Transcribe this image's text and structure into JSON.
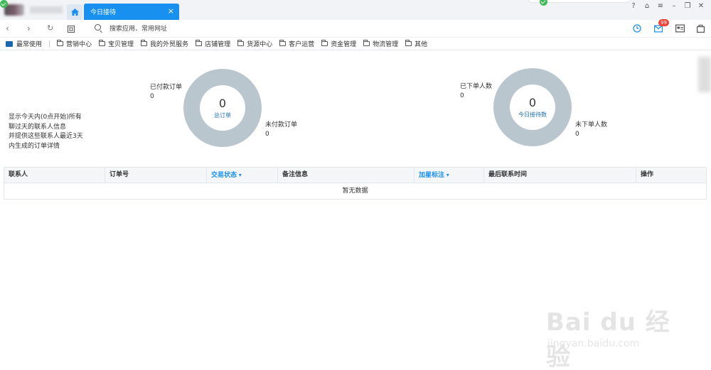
{
  "titlebar": {
    "tab_label": "今日接待",
    "tab_close": "×",
    "home_icon": "home-icon",
    "window_controls": [
      "?",
      "⌂",
      "≡",
      "–",
      "❐",
      "✕"
    ]
  },
  "navbar": {
    "back": "‹",
    "forward": "›",
    "refresh": "↻",
    "search_placeholder": "搜索应用、常用网址",
    "mail_badge": "99"
  },
  "bookmarks": [
    "最常使用",
    "营销中心",
    "宝贝管理",
    "我的外贸服务",
    "店铺管理",
    "货源中心",
    "客户运营",
    "资金管理",
    "物流管理",
    "其他"
  ],
  "description": [
    "显示今天内(0点开始)所有",
    "聊过天的联系人信息",
    "并提供这些联系人最近3天",
    "内生成的订单详情"
  ],
  "donut1": {
    "top_label": "已付款订单",
    "top_value": "0",
    "center_value": "0",
    "center_caption": "总订单",
    "bottom_label": "未付款订单",
    "bottom_value": "0",
    "color": "#b9c6cd"
  },
  "donut2": {
    "top_label": "已下单人数",
    "top_value": "0",
    "center_value": "0",
    "center_caption": "今日接待数",
    "bottom_label": "未下单人数",
    "bottom_value": "0",
    "color": "#b9c6cd"
  },
  "table": {
    "columns": [
      "联系人",
      "订单号",
      "交易状态",
      "备注信息",
      "加星标注",
      "最后联系时间",
      "操作"
    ],
    "empty_text": "暂无数据"
  },
  "watermark": {
    "main": "Bai du 经验",
    "sub": "jingyan.baidu.com"
  }
}
